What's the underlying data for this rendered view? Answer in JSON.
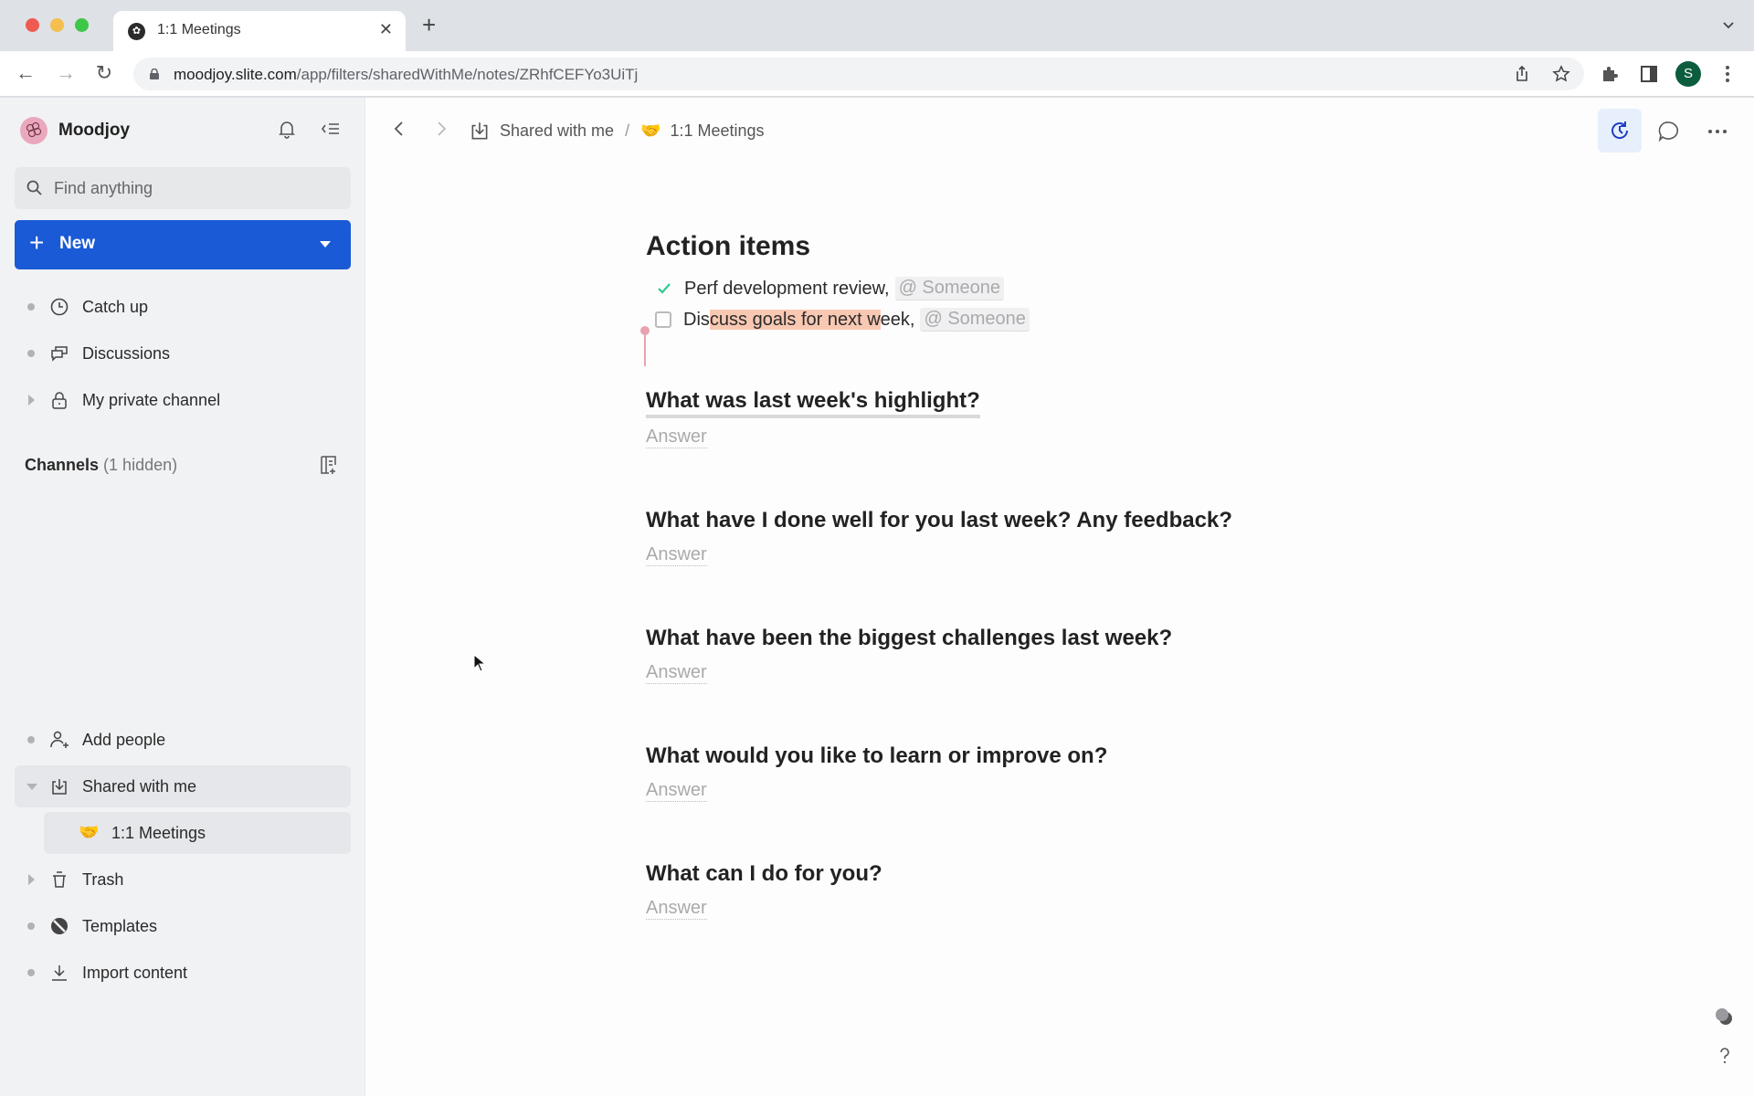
{
  "browser": {
    "tab_title": "1:1 Meetings",
    "url_host": "moodjoy.slite.com",
    "url_path": "/app/filters/sharedWithMe/notes/ZRhfCEFYo3UiTj",
    "profile_initial": "S"
  },
  "sidebar": {
    "workspace_name": "Moodjoy",
    "search_placeholder": "Find anything",
    "new_label": "New",
    "top_items": [
      {
        "label": "Catch up",
        "icon": "clock-icon"
      },
      {
        "label": "Discussions",
        "icon": "chat-bubbles-icon"
      },
      {
        "label": "My private channel",
        "icon": "lock-icon"
      }
    ],
    "channels_title": "Channels",
    "channels_hidden": "(1 hidden)",
    "bottom_items": [
      {
        "label": "Add people",
        "icon": "add-person-icon"
      },
      {
        "label": "Shared with me",
        "icon": "inbox-download-icon"
      },
      {
        "label": "1:1 Meetings",
        "icon": "handshake-emoji",
        "emoji": "🤝"
      },
      {
        "label": "Trash",
        "icon": "trash-icon"
      },
      {
        "label": "Templates",
        "icon": "templates-icon"
      },
      {
        "label": "Import content",
        "icon": "import-icon"
      }
    ]
  },
  "breadcrumb": {
    "parent": "Shared with me",
    "separator": "/",
    "current_emoji": "🤝",
    "current": "1:1 Meetings"
  },
  "doc": {
    "action_title": "Action items",
    "tasks": [
      {
        "done": true,
        "text": "Perf development review,",
        "mention": "@ Someone"
      },
      {
        "done": false,
        "text_pre": "Dis",
        "text_hl": "cuss goals for next w",
        "text_post": "eek,",
        "mention": "@ Someone"
      }
    ],
    "questions": [
      {
        "title": "What was last week's highlight?",
        "answer": "Answer"
      },
      {
        "title": "What have I done well for you last week? Any feedback?",
        "answer": "Answer"
      },
      {
        "title": "What have been the biggest challenges last week?",
        "answer": "Answer"
      },
      {
        "title": "What would you like to learn or improve on?",
        "answer": "Answer"
      },
      {
        "title": "What can I do for you?",
        "answer": "Answer"
      }
    ]
  },
  "colors": {
    "accent": "#1a5ad7",
    "highlight": "#f8c8b3",
    "check": "#2ecc8f"
  }
}
